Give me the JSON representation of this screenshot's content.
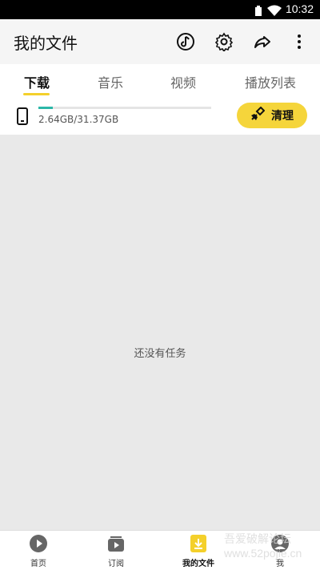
{
  "status": {
    "time": "10:32"
  },
  "header": {
    "title": "我的文件",
    "icons": [
      "music-icon",
      "settings-icon",
      "share-icon",
      "more-icon"
    ]
  },
  "tabs": [
    {
      "label": "下载",
      "active": true
    },
    {
      "label": "音乐",
      "active": false
    },
    {
      "label": "视频",
      "active": false
    },
    {
      "label": "播放列表",
      "active": false
    }
  ],
  "storage": {
    "text": "2.64GB/31.37GB",
    "used_fraction": 0.084
  },
  "clean_button": {
    "label": "清理"
  },
  "empty_message": "还没有任务",
  "bottom_nav": [
    {
      "label": "首页",
      "icon": "play-circle-icon",
      "active": false
    },
    {
      "label": "订阅",
      "icon": "subscribe-icon",
      "active": false
    },
    {
      "label": "我的文件",
      "icon": "download-file-icon",
      "active": true
    },
    {
      "label": "我",
      "icon": "person-icon",
      "active": false
    }
  ],
  "colors": {
    "accent": "#f4d02b",
    "progress": "#2cb7a8",
    "background": "#e9e9e9"
  },
  "watermark": {
    "line1": "吾爱破解论坛",
    "line2": "www.52pojie.cn"
  }
}
